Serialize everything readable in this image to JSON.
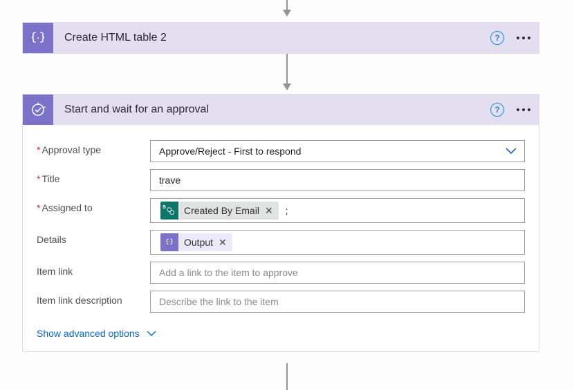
{
  "summary": "Power Automate flow designer showing two action cards connected by arrows.",
  "card1": {
    "title": "Create HTML table 2",
    "icon": "braces-icon"
  },
  "card2": {
    "title": "Start and wait for an approval",
    "icon": "approval-check-icon",
    "fields": {
      "approval_type": {
        "label": "Approval type",
        "required": true,
        "value": "Approve/Reject - First to respond"
      },
      "title": {
        "label": "Title",
        "required": true,
        "value": "trave"
      },
      "assigned_to": {
        "label": "Assigned to",
        "required": true,
        "token": {
          "source": "sharepoint",
          "text": "Created By Email"
        },
        "suffix": ";"
      },
      "details": {
        "label": "Details",
        "required": false,
        "token": {
          "source": "data-operation",
          "text": "Output"
        }
      },
      "item_link": {
        "label": "Item link",
        "required": false,
        "placeholder": "Add a link to the item to approve"
      },
      "item_link_desc": {
        "label": "Item link description",
        "required": false,
        "placeholder": "Describe the link to the item"
      }
    },
    "advanced_link": "Show advanced options"
  }
}
